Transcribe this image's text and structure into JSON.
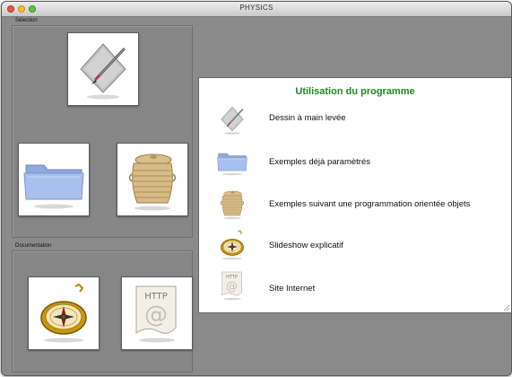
{
  "window": {
    "title": "PHYSICS"
  },
  "selection": {
    "label": "Sélection",
    "tiles": [
      {
        "icon": "drawing-pencil-icon"
      },
      {
        "icon": "folder-icon"
      },
      {
        "icon": "basket-icon"
      }
    ]
  },
  "documentation": {
    "label": "Documentation",
    "tiles": [
      {
        "icon": "compass-icon"
      },
      {
        "icon": "http-document-icon",
        "text": "HTTP",
        "symbol": "@"
      }
    ]
  },
  "usage": {
    "title": "Utilisation du programme",
    "items": [
      {
        "icon": "drawing-pencil-icon",
        "label": "Dessin à main levée"
      },
      {
        "icon": "folder-icon",
        "label": "Exemples déjà paramètrés"
      },
      {
        "icon": "basket-icon",
        "label": "Exemples suivant une programmation orientée objets"
      },
      {
        "icon": "compass-icon",
        "label": "Slideshow explicatif"
      },
      {
        "icon": "http-document-icon",
        "label": "Site Internet",
        "icon_text": "HTTP",
        "icon_symbol": "@"
      }
    ]
  },
  "colors": {
    "heading": "#1e8a1e",
    "window_bg": "#8a8a8a"
  }
}
